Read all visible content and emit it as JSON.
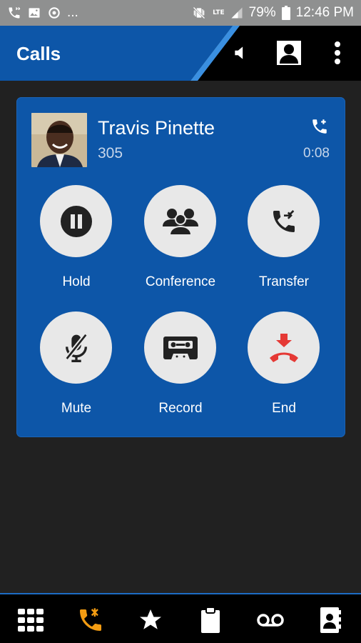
{
  "status_bar": {
    "ellipsis": "...",
    "network": "LTE",
    "battery": "79%",
    "time": "12:46 PM"
  },
  "app_bar": {
    "title": "Calls"
  },
  "call": {
    "name": "Travis Pinette",
    "extension": "305",
    "duration": "0:08"
  },
  "actions": {
    "hold": "Hold",
    "conference": "Conference",
    "transfer": "Transfer",
    "mute": "Mute",
    "record": "Record",
    "end": "End"
  },
  "nav": {
    "active": "calls",
    "items": [
      "dialpad",
      "calls",
      "favorites",
      "clipboard",
      "voicemail",
      "contacts"
    ]
  },
  "colors": {
    "brand_blue": "#0d56a8",
    "accent_orange": "#f39c12",
    "end_red": "#e53935"
  }
}
